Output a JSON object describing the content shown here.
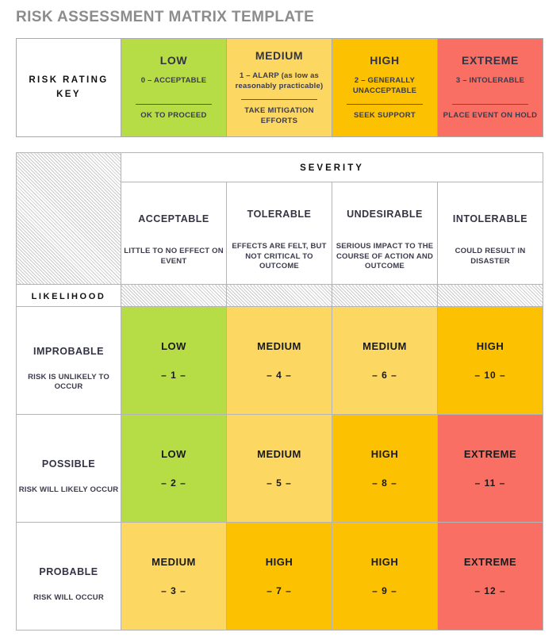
{
  "page": {
    "title": "RISK ASSESSMENT MATRIX TEMPLATE"
  },
  "colors": {
    "low": "#b6dc46",
    "medium": "#fcd761",
    "high": "#fcc202",
    "extreme": "#f96f64",
    "title_gray": "#8c8c8c",
    "border_gray": "#b0b0b0",
    "hatch_gray": "#c9c9c9"
  },
  "risk_rating_key": {
    "label": "RISK RATING KEY",
    "label_line1": "RISK RATING",
    "label_line2": "KEY",
    "levels": [
      {
        "name": "LOW",
        "score": "0 – ACCEPTABLE",
        "action": "OK TO PROCEED",
        "color": "#b6dc46"
      },
      {
        "name": "MEDIUM",
        "score": "1 – ALARP (as low as reasonably practicable)",
        "action": "TAKE MITIGATION EFFORTS",
        "color": "#fcd761"
      },
      {
        "name": "HIGH",
        "score": "2 – GENERALLY UNACCEPTABLE",
        "action": "SEEK SUPPORT",
        "color": "#fcc202"
      },
      {
        "name": "EXTREME",
        "score": "3 – INTOLERABLE",
        "action": "PLACE EVENT ON HOLD",
        "color": "#f96f64"
      }
    ]
  },
  "matrix": {
    "severity_header": "SEVERITY",
    "likelihood_header": "LIKELIHOOD",
    "severity_columns": [
      {
        "name": "ACCEPTABLE",
        "description": "LITTLE TO NO EFFECT ON EVENT"
      },
      {
        "name": "TOLERABLE",
        "description": "EFFECTS ARE FELT, BUT NOT CRITICAL TO OUTCOME"
      },
      {
        "name": "UNDESIRABLE",
        "description": "SERIOUS IMPACT TO THE COURSE OF ACTION AND OUTCOME"
      },
      {
        "name": "INTOLERABLE",
        "description": "COULD RESULT IN DISASTER"
      }
    ],
    "likelihood_rows": [
      {
        "name": "IMPROBABLE",
        "description": "RISK IS UNLIKELY TO OCCUR",
        "cells": [
          {
            "label": "LOW",
            "number": "– 1 –",
            "level": "low"
          },
          {
            "label": "MEDIUM",
            "number": "– 4 –",
            "level": "medium"
          },
          {
            "label": "MEDIUM",
            "number": "– 6 –",
            "level": "medium"
          },
          {
            "label": "HIGH",
            "number": "– 10 –",
            "level": "high"
          }
        ]
      },
      {
        "name": "POSSIBLE",
        "description": "RISK WILL LIKELY OCCUR",
        "cells": [
          {
            "label": "LOW",
            "number": "– 2 –",
            "level": "low"
          },
          {
            "label": "MEDIUM",
            "number": "– 5 –",
            "level": "medium"
          },
          {
            "label": "HIGH",
            "number": "– 8 –",
            "level": "high"
          },
          {
            "label": "EXTREME",
            "number": "– 11 –",
            "level": "extreme"
          }
        ]
      },
      {
        "name": "PROBABLE",
        "description": "RISK WILL OCCUR",
        "cells": [
          {
            "label": "MEDIUM",
            "number": "– 3 –",
            "level": "medium"
          },
          {
            "label": "HIGH",
            "number": "– 7 –",
            "level": "high"
          },
          {
            "label": "HIGH",
            "number": "– 9 –",
            "level": "high"
          },
          {
            "label": "EXTREME",
            "number": "– 12 –",
            "level": "extreme"
          }
        ]
      }
    ]
  }
}
